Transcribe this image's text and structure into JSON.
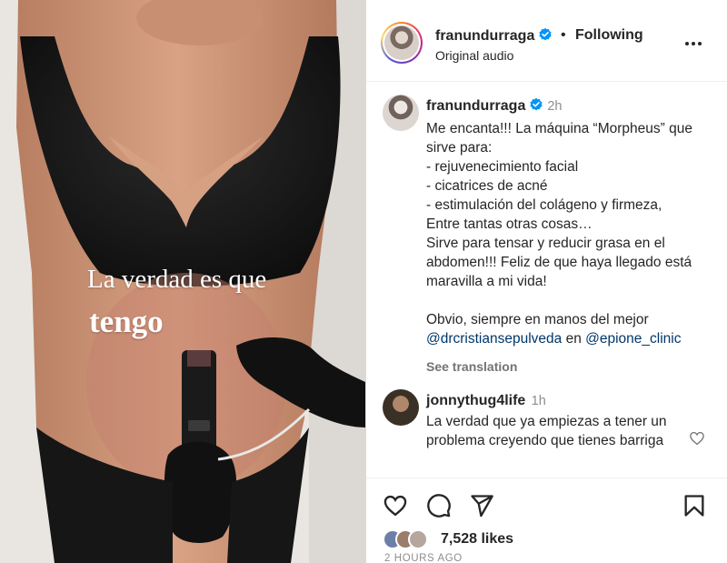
{
  "post": {
    "overlay_line1": "La verdad es que",
    "overlay_line2": "tengo"
  },
  "header": {
    "username": "franundurraga",
    "dot": "•",
    "follow_state": "Following",
    "audio": "Original audio",
    "more_icon": "more-horizontal-icon"
  },
  "caption": {
    "username": "franundurraga",
    "time": "2h",
    "text": "Me encanta!!! La máquina “Morpheus” que sirve para:\n- rejuvenecimiento facial\n- cicatrices de acné\n- estimulación del colágeno y firmeza,\nEntre tantas otras cosas…\nSirve para tensar y reducir grasa en el abdomen!!! Feliz de que haya llegado está maravilla a mi vida!\n\nObvio, siempre en manos del mejor ",
    "mention1": "@drcristiansepulveda",
    "connector": " en ",
    "mention2": "@epione_clinic",
    "see_translation": "See translation"
  },
  "comment": {
    "username": "jonnythug4life",
    "time": "1h",
    "text": "La verdad que ya empiezas a tener un problema creyendo que tienes barriga",
    "like_icon": "heart-outline-icon"
  },
  "actions": {
    "like_icon": "heart-icon",
    "comment_icon": "comment-icon",
    "share_icon": "send-icon",
    "save_icon": "bookmark-icon",
    "likes": "7,528 likes",
    "time_ago": "2 HOURS AGO"
  },
  "colors": {
    "text": "#262626",
    "secondary": "#8e8e8e",
    "link": "#00376b",
    "verified": "#0095f6"
  }
}
